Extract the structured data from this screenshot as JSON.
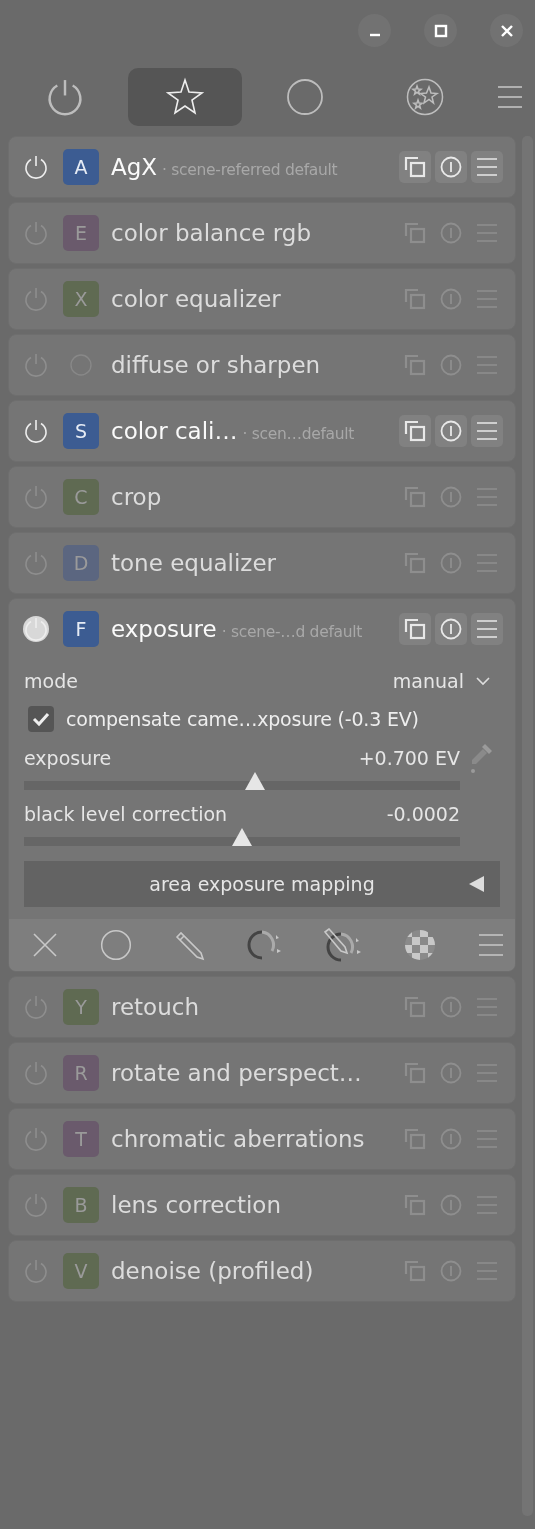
{
  "tabs": [
    {
      "kind": "power",
      "selected": false
    },
    {
      "kind": "star",
      "selected": true
    },
    {
      "kind": "circle",
      "selected": false
    },
    {
      "kind": "stars",
      "selected": false
    }
  ],
  "modules": [
    {
      "key": "A",
      "color": "#3c5c92",
      "name": "AgX",
      "label": "· scene-referred default",
      "enabled": true,
      "expanded": false
    },
    {
      "key": "E",
      "color": "#6a5a6c",
      "name": "color balance rgb",
      "enabled": false,
      "expanded": false
    },
    {
      "key": "X",
      "color": "#5f6a52",
      "name": "color equalizer",
      "enabled": false,
      "expanded": false
    },
    {
      "name": "diffuse or sharpen",
      "enabled": false,
      "expanded": false
    },
    {
      "key": "S",
      "color": "#3c5c92",
      "name": "color cali…",
      "label": "· scen…default",
      "enabled": true,
      "expanded": false
    },
    {
      "key": "C",
      "color": "#5f6a52",
      "name": "crop",
      "enabled": false,
      "expanded": false
    },
    {
      "key": "D",
      "color": "#5b6680",
      "name": "tone equalizer",
      "enabled": false,
      "expanded": false
    },
    {
      "key": "F",
      "color": "#3c5c92",
      "name": "exposure",
      "label": "· scene-…d default",
      "enabled": true,
      "expanded": true,
      "controls": {
        "mode": {
          "label": "mode",
          "value": "manual"
        },
        "checkbox": {
          "label": "compensate came…xposure (-0.3 EV)",
          "checked": true
        },
        "sliders": [
          {
            "label": "exposure",
            "reading": "+0.700 EV",
            "level": 0.53,
            "picker": true
          },
          {
            "label": "black level correction",
            "reading": "-0.0002",
            "level": 0.5,
            "picker": false
          }
        ],
        "section": {
          "label": "area exposure mapping",
          "expanded": false
        },
        "masks": [
          {
            "kind": "off"
          },
          {
            "kind": "uniform"
          },
          {
            "kind": "drawn"
          },
          {
            "kind": "parametric"
          },
          {
            "kind": "drawn-parametric"
          },
          {
            "kind": "raster"
          },
          {
            "kind": "menu"
          }
        ]
      }
    },
    {
      "key": "Y",
      "color": "#5f6a52",
      "name": "retouch",
      "enabled": false,
      "expanded": false
    },
    {
      "key": "R",
      "color": "#6a5a6c",
      "name": "rotate and perspect…",
      "enabled": false,
      "expanded": false
    },
    {
      "key": "T",
      "color": "#6a5a6c",
      "name": "chromatic aberrations",
      "enabled": false,
      "expanded": false
    },
    {
      "key": "B",
      "color": "#5f6a52",
      "name": "lens correction",
      "enabled": false,
      "expanded": false
    },
    {
      "key": "V",
      "color": "#5f6a52",
      "name": "denoise (profiled)",
      "enabled": false,
      "expanded": false
    }
  ]
}
